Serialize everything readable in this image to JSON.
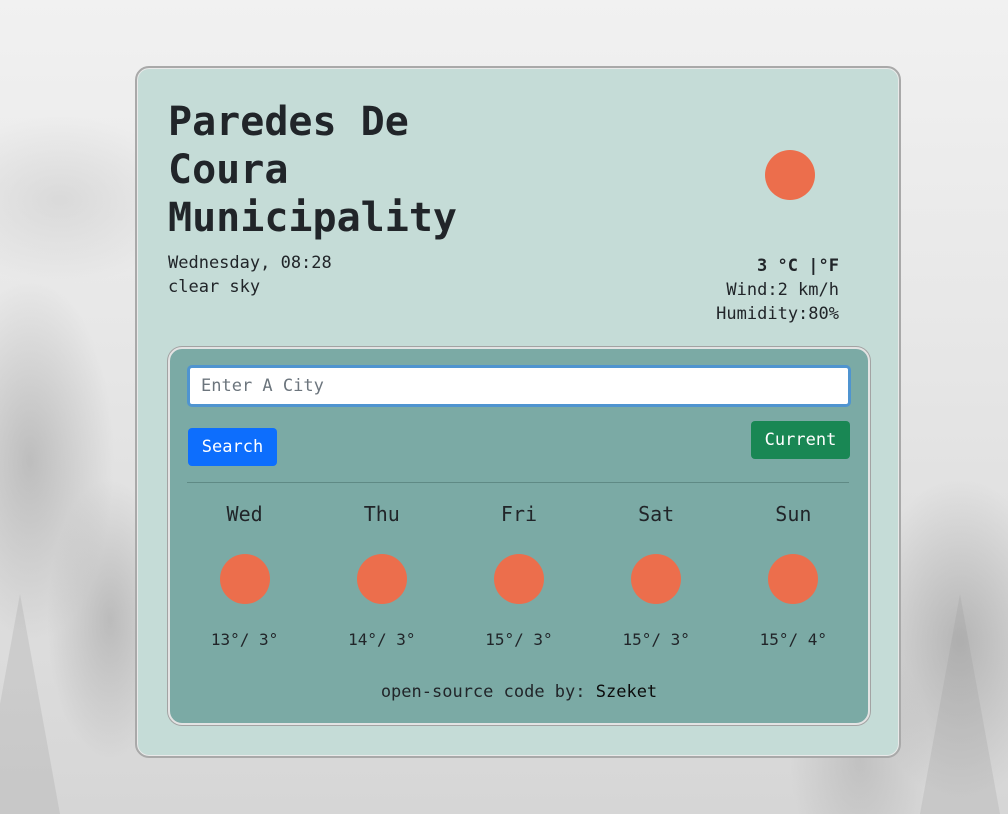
{
  "location": {
    "city": "Paredes De Coura Municipality",
    "datetime": "Wednesday, 08:28",
    "description": "clear sky",
    "icon": "sun-icon"
  },
  "current": {
    "temp_value": "3",
    "unit_c": "°C",
    "separator": " |",
    "unit_f": "°F",
    "wind": "Wind:2 km/h",
    "humidity": "Humidity:80%"
  },
  "search": {
    "placeholder": "Enter A City",
    "value": "",
    "search_label": "Search",
    "current_label": "Current"
  },
  "forecast": [
    {
      "day": "Wed",
      "temps": "13°/ 3°",
      "icon": "sun-icon"
    },
    {
      "day": "Thu",
      "temps": "14°/ 3°",
      "icon": "sun-icon"
    },
    {
      "day": "Fri",
      "temps": "15°/ 3°",
      "icon": "sun-icon"
    },
    {
      "day": "Sat",
      "temps": "15°/ 3°",
      "icon": "sun-icon"
    },
    {
      "day": "Sun",
      "temps": "15°/ 4°",
      "icon": "sun-icon"
    }
  ],
  "footer": {
    "text": "open-source code by: ",
    "link": "Szeket"
  },
  "colors": {
    "card": "#c5dcd7",
    "panel": "#7baaa5",
    "sun": "#ec6e4c",
    "search_button": "#0d6efd",
    "current_button": "#198754"
  }
}
